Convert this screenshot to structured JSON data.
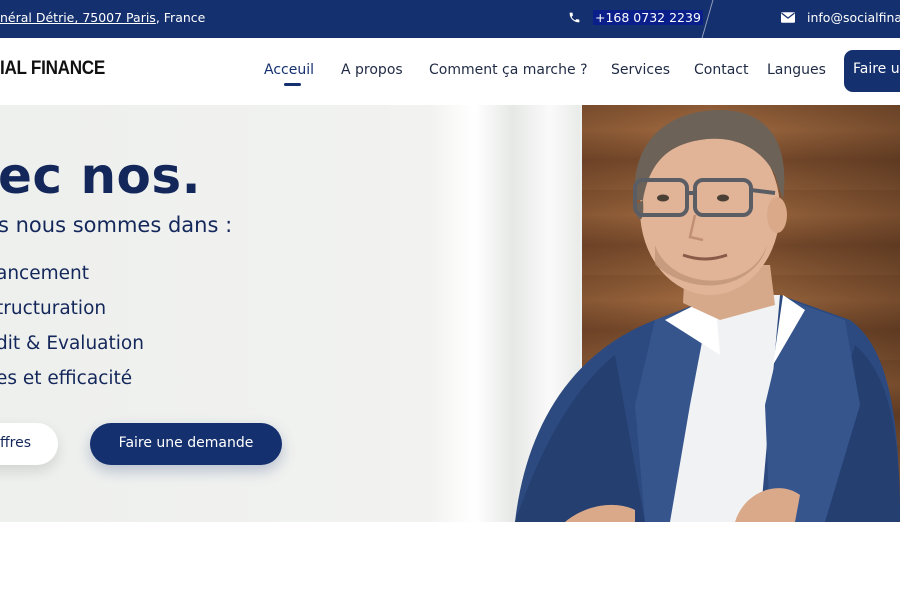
{
  "topbar": {
    "address_link": "néral Détrie, 75007 Paris",
    "address_rest": ", France",
    "phone": "+168 0732 2239",
    "email": "info@socialfinar"
  },
  "header": {
    "logo_text": "IAL FINANCE",
    "nav": [
      {
        "label": "Acceuil"
      },
      {
        "label": "A propos"
      },
      {
        "label": "Comment ça marche ?"
      },
      {
        "label": "Services"
      },
      {
        "label": "Contact"
      },
      {
        "label": "Langues"
      }
    ],
    "cta_label": "Faire un"
  },
  "hero": {
    "title": "ec nos.",
    "subtitle": "s nous sommes dans :",
    "services": [
      "ancement",
      "tructuration",
      "dit & Evaluation",
      "es et efficacité"
    ],
    "btn_offres": "ffres",
    "btn_demande": "Faire une demande"
  },
  "icons": {
    "phone": "phone-icon",
    "email": "envelope-icon"
  },
  "colors": {
    "brand_navy": "#14306e",
    "text_navy": "#14275a"
  }
}
